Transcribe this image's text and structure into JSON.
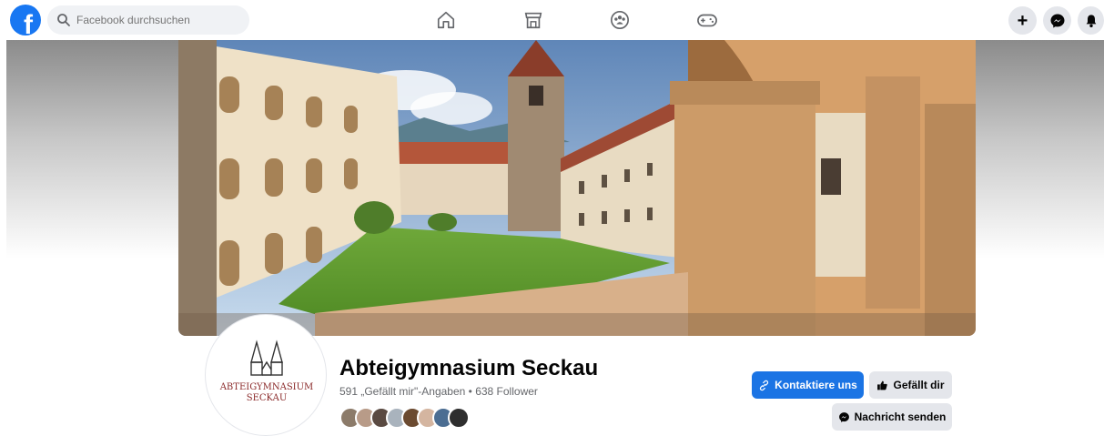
{
  "topbar": {
    "logo_letter": "f",
    "search_placeholder": "Facebook durchsuchen",
    "nav_icons": [
      "home-icon",
      "marketplace-icon",
      "groups-icon",
      "gaming-icon"
    ],
    "right_icons": [
      "plus-icon",
      "messenger-icon",
      "notifications-bell-icon"
    ],
    "plus_glyph": "+"
  },
  "profile": {
    "name": "Abteigymnasium Seckau",
    "stats": "591 „Gefällt mir\"-Angaben • 638 Follower",
    "avatar_logo_line1": "ABTEIGYMNASIUM",
    "avatar_logo_line2": "SECKAU",
    "friend_avatar_count": 8
  },
  "actions": {
    "contact_label": "Kontaktiere uns",
    "like_label": "Gefällt dir",
    "message_label": "Nachricht senden"
  },
  "colors": {
    "brand_blue": "#1877f2",
    "primary_button": "#1b74e4",
    "secondary_button": "#e4e6eb",
    "logo_red": "#8b2a2a"
  }
}
